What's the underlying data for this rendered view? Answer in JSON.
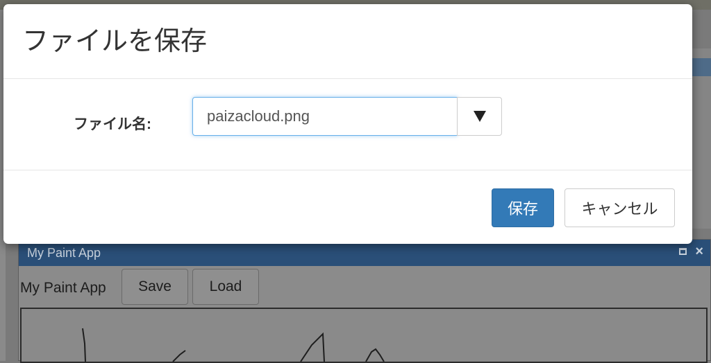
{
  "dialog": {
    "title": "ファイルを保存",
    "filename_label": "ファイル名:",
    "filename_value": "paizacloud.png",
    "dropdown_icon": "triangle-down-icon",
    "save_label": "保存",
    "cancel_label": "キャンセル"
  },
  "paint_window": {
    "title": "My Paint App",
    "app_label": "My Paint App",
    "save_label": "Save",
    "load_label": "Load"
  },
  "colors": {
    "primary_button": "#337ab7",
    "input_focus": "#66afe9",
    "window_titlebar": "#2a4f78"
  }
}
